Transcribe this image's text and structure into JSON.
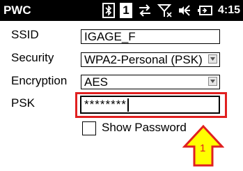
{
  "titlebar": {
    "app_title": "PWC",
    "status_icons": [
      "bluetooth-icon",
      "notification-count-icon",
      "data-connection-icon",
      "signal-icon",
      "volume-icon",
      "battery-icon"
    ],
    "notification_count": "1",
    "clock": "4:15"
  },
  "form": {
    "ssid": {
      "label": "SSID",
      "value": "IGAGE_F"
    },
    "security": {
      "label": "Security",
      "value": "WPA2-Personal (PSK)"
    },
    "encryption": {
      "label": "Encryption",
      "value": "AES"
    },
    "psk": {
      "label": "PSK",
      "value": "********"
    },
    "show_password": {
      "label": "Show Password",
      "checked": false
    }
  },
  "annotation": {
    "callout_number": "1",
    "highlight_color": "#e02020",
    "callout_fill": "#ffff00",
    "callout_stroke": "#e02020"
  }
}
